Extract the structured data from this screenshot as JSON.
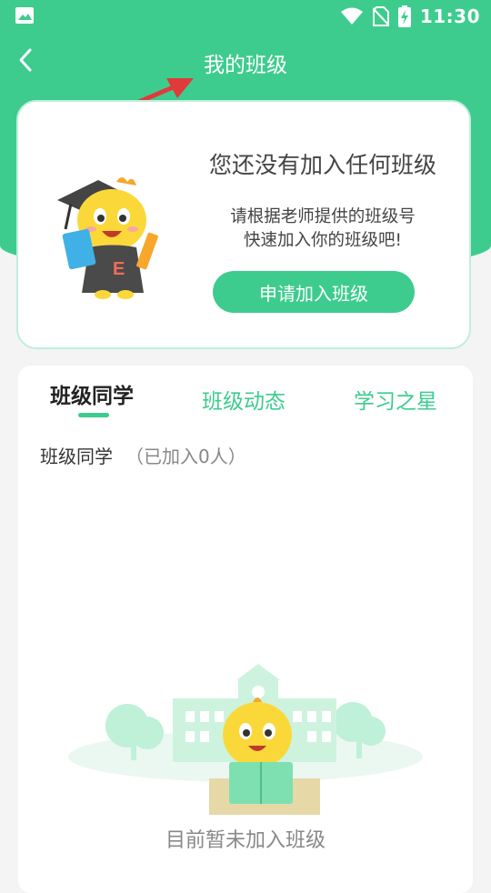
{
  "status_bar": {
    "time": "11:30",
    "icons": [
      "image-icon",
      "wifi-icon",
      "no-sim-icon",
      "battery-charging-icon"
    ]
  },
  "header": {
    "title": "我的班级",
    "back_icon": "back-chevron-icon",
    "accent_color": "#3ecc8e"
  },
  "join_card": {
    "title": "您还没有加入任何班级",
    "subtitle_line1": "请根据老师提供的班级号",
    "subtitle_line2": "快速加入你的班级吧!",
    "button_label": "申请加入班级"
  },
  "tabs": [
    {
      "label": "班级同学",
      "active": true
    },
    {
      "label": "班级动态",
      "active": false
    },
    {
      "label": "学习之星",
      "active": false
    }
  ],
  "members": {
    "label": "班级同学",
    "count_text": "（已加入0人）"
  },
  "empty_state": {
    "text": "目前暂未加入班级"
  }
}
